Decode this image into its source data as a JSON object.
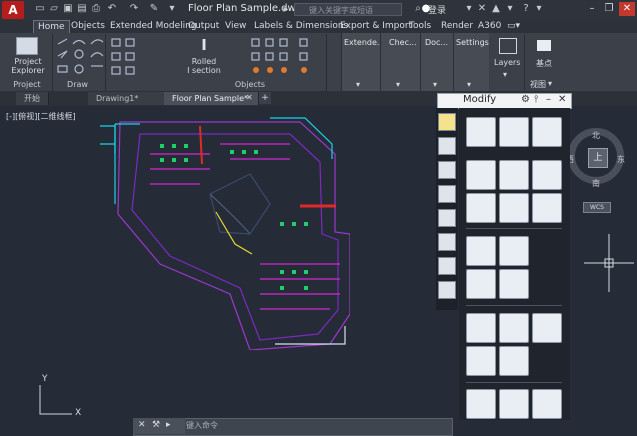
{
  "app": {
    "logo": "A",
    "title": "Floor Plan Sample.dwg",
    "search_placeholder": "键入关键字或短语",
    "login": "登录"
  },
  "menu_tabs": [
    "Home",
    "Objects",
    "Extended Modeling",
    "Output",
    "View",
    "Labels & Dimensions",
    "Export & Import",
    "Tools",
    "Render",
    "A360"
  ],
  "ribbon": {
    "project_explorer": "Project\nExplorer",
    "project": "Project",
    "draw": "Draw",
    "rolled_section": "Rolled\nI section",
    "objects": "Objects",
    "extended": "Extende...",
    "check": "Chec...",
    "doc": "Doc...",
    "settings": "Settings",
    "layers": "Layers",
    "base_point": "基点",
    "view": "视图"
  },
  "doc_tabs": [
    "开始",
    "Drawing1*",
    "Floor Plan Sample*"
  ],
  "viewport_label": "[-][俯视][二维线框]",
  "modify_palette": {
    "title": "Modify"
  },
  "nav": {
    "north": "北",
    "south": "南",
    "east": "东",
    "west": "西",
    "top": "上",
    "wcs": "WCS"
  },
  "ucs": {
    "x": "X",
    "y": "Y"
  },
  "command": {
    "placeholder": "键入命令"
  },
  "colors": {
    "background": "#252b37",
    "ribbon": "#3b4049",
    "accent_red": "#b71c1c"
  }
}
